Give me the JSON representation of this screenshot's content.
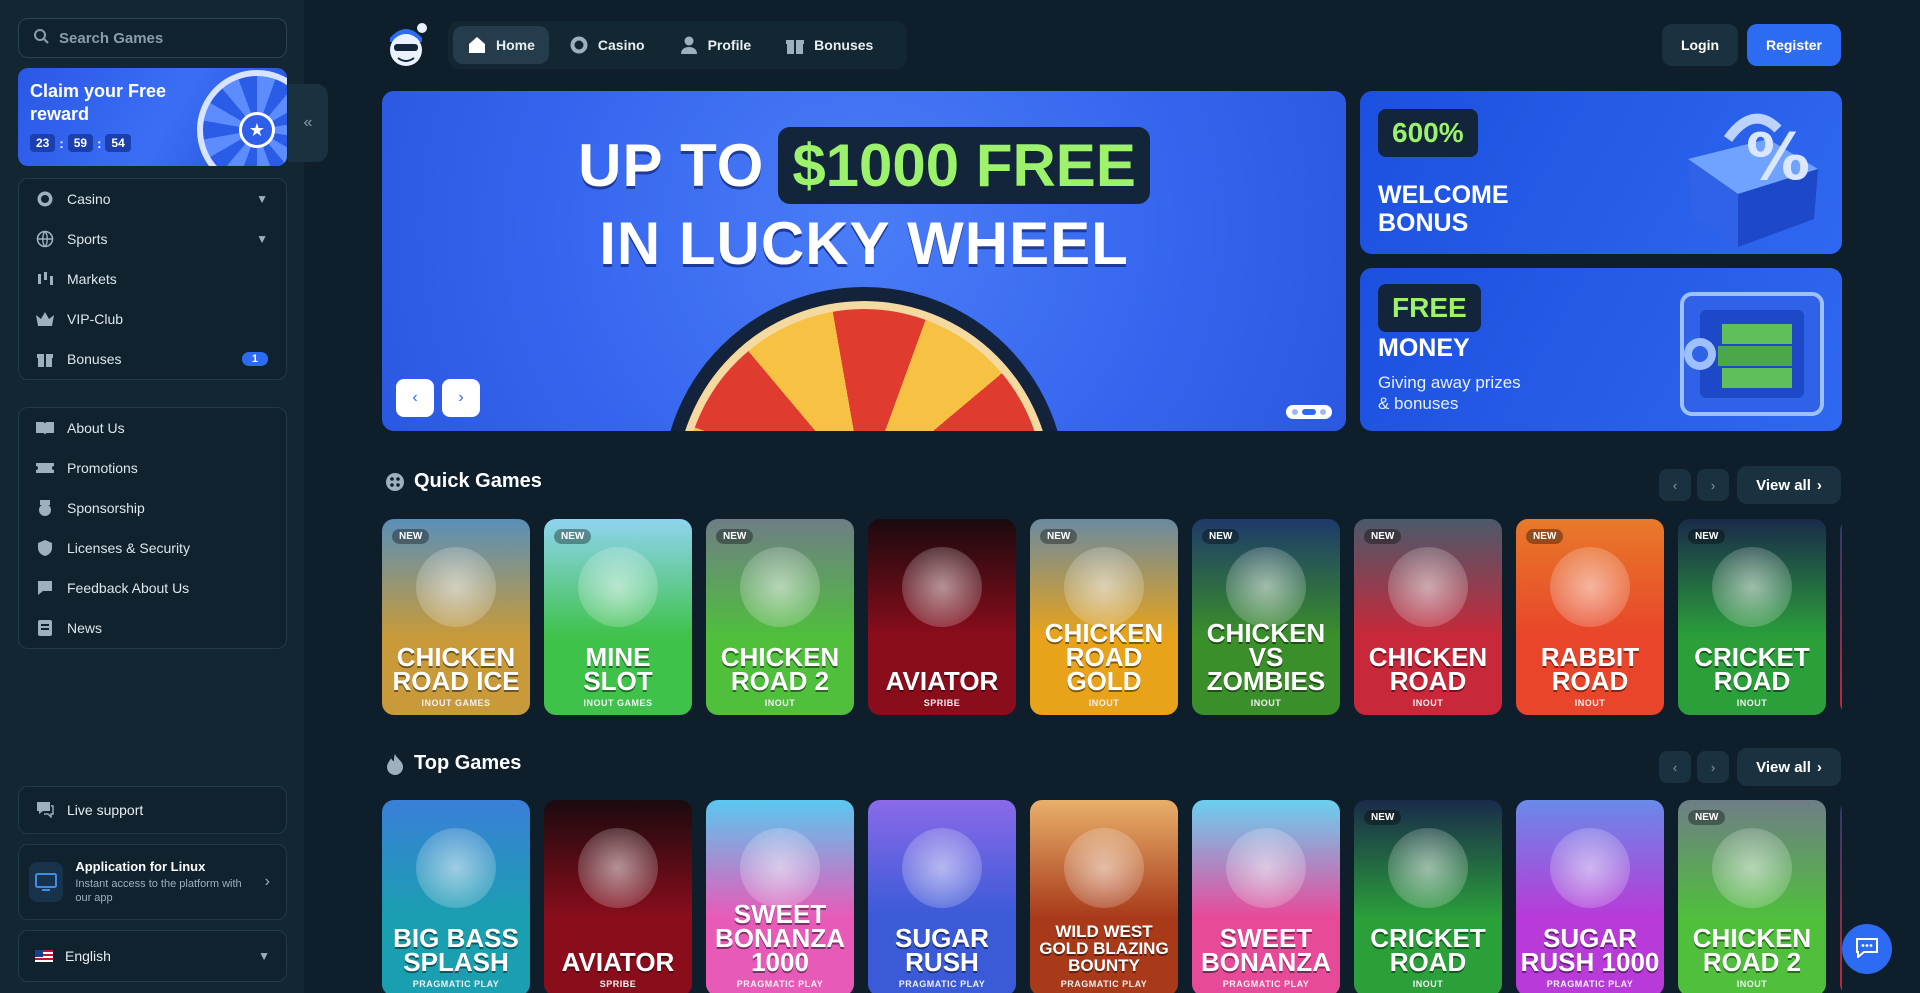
{
  "search": {
    "placeholder": "Search Games"
  },
  "reward": {
    "title": "Claim your Free reward",
    "hours": "23",
    "minutes": "59",
    "seconds": "54"
  },
  "sidebar": {
    "main_items": [
      {
        "label": "Casino"
      },
      {
        "label": "Sports"
      },
      {
        "label": "Markets"
      },
      {
        "label": "VIP-Club"
      },
      {
        "label": "Bonuses",
        "badge": "1"
      }
    ],
    "info_items": [
      {
        "label": "About Us"
      },
      {
        "label": "Promotions"
      },
      {
        "label": "Sponsorship"
      },
      {
        "label": "Licenses & Security"
      },
      {
        "label": "Feedback About Us"
      },
      {
        "label": "News"
      }
    ],
    "live_support": "Live support",
    "app": {
      "title": "Application for Linux",
      "subtitle": "Instant access to the platform with our app"
    },
    "language": "English"
  },
  "topnav": {
    "tabs": [
      {
        "label": "Home"
      },
      {
        "label": "Casino"
      },
      {
        "label": "Profile"
      },
      {
        "label": "Bonuses"
      }
    ],
    "login": "Login",
    "register": "Register"
  },
  "hero": {
    "line1_a": "UP TO",
    "line1_b": "$1000 FREE",
    "line2": "IN LUCKY WHEEL"
  },
  "promos": [
    {
      "tag": "600%",
      "head": "WELCOME BONUS"
    },
    {
      "tag": "FREE",
      "head": "MONEY",
      "sub": "Giving away prizes & bonuses"
    }
  ],
  "quick_games": {
    "title": "Quick Games",
    "view_all": "View all",
    "new_label": "NEW",
    "cards": [
      {
        "name": "CHICKEN ROAD ICE",
        "provider": "INOUT GAMES",
        "new": true,
        "color": "#c89a3a",
        "color2": "#5a8fb8"
      },
      {
        "name": "MINE SLOT",
        "provider": "INOUT GAMES",
        "new": true,
        "color": "#3fc24a",
        "color2": "#8fd4f0"
      },
      {
        "name": "CHICKEN ROAD 2",
        "provider": "INOUT",
        "new": true,
        "color": "#4fbf3c",
        "color2": "#6f7d86"
      },
      {
        "name": "AVIATOR",
        "provider": "SPRIBE",
        "new": false,
        "color": "#8a0d1c",
        "color2": "#1a0a0e"
      },
      {
        "name": "CHICKEN ROAD GOLD",
        "provider": "INOUT",
        "new": true,
        "color": "#e8a31a",
        "color2": "#6a8aa0"
      },
      {
        "name": "CHICKEN VS ZOMBIES",
        "provider": "INOUT",
        "new": true,
        "color": "#3a8f2a",
        "color2": "#1e3a6a"
      },
      {
        "name": "CHICKEN ROAD",
        "provider": "INOUT",
        "new": true,
        "color": "#c8283a",
        "color2": "#4a5a6a"
      },
      {
        "name": "RABBIT ROAD",
        "provider": "INOUT",
        "new": true,
        "color": "#e8452a",
        "color2": "#e87a2a"
      },
      {
        "name": "CRICKET ROAD",
        "provider": "INOUT",
        "new": true,
        "color": "#2a9f3a",
        "color2": "#1a2a4a"
      }
    ]
  },
  "top_games": {
    "title": "Top Games",
    "view_all": "View all",
    "new_label": "NEW",
    "cards": [
      {
        "name": "BIG BASS SPLASH",
        "provider": "PRAGMATIC PLAY",
        "new": false,
        "color": "#1a9fb0",
        "color2": "#3a7fd8"
      },
      {
        "name": "AVIATOR",
        "provider": "SPRIBE",
        "new": false,
        "color": "#8a0d1c",
        "color2": "#1a0a0e"
      },
      {
        "name": "SWEET BONANZA 1000",
        "provider": "PRAGMATIC PLAY",
        "new": false,
        "color": "#e85ab8",
        "color2": "#5ac8f0"
      },
      {
        "name": "SUGAR RUSH",
        "provider": "PRAGMATIC PLAY",
        "new": false,
        "color": "#3a5ad8",
        "color2": "#8a6ae8"
      },
      {
        "name": "WILD WEST GOLD BLAZING BOUNTY",
        "provider": "PRAGMATIC PLAY",
        "new": false,
        "color": "#a83a1a",
        "color2": "#e8b06a"
      },
      {
        "name": "SWEET BONANZA",
        "provider": "PRAGMATIC PLAY",
        "new": false,
        "color": "#e84a9a",
        "color2": "#6ad0f0"
      },
      {
        "name": "CRICKET ROAD",
        "provider": "INOUT",
        "new": true,
        "color": "#2a9f3a",
        "color2": "#1a2a4a"
      },
      {
        "name": "SUGAR RUSH 1000",
        "provider": "PRAGMATIC PLAY",
        "new": false,
        "color": "#b83ad8",
        "color2": "#6a8ae8"
      },
      {
        "name": "CHICKEN ROAD 2",
        "provider": "INOUT",
        "new": true,
        "color": "#4fbf3c",
        "color2": "#6f7d86"
      }
    ]
  },
  "colors": {
    "accent": "#2d6cf2",
    "bg": "#0e1f2b",
    "sidebar": "#132733",
    "highlight": "#9cf26b"
  }
}
